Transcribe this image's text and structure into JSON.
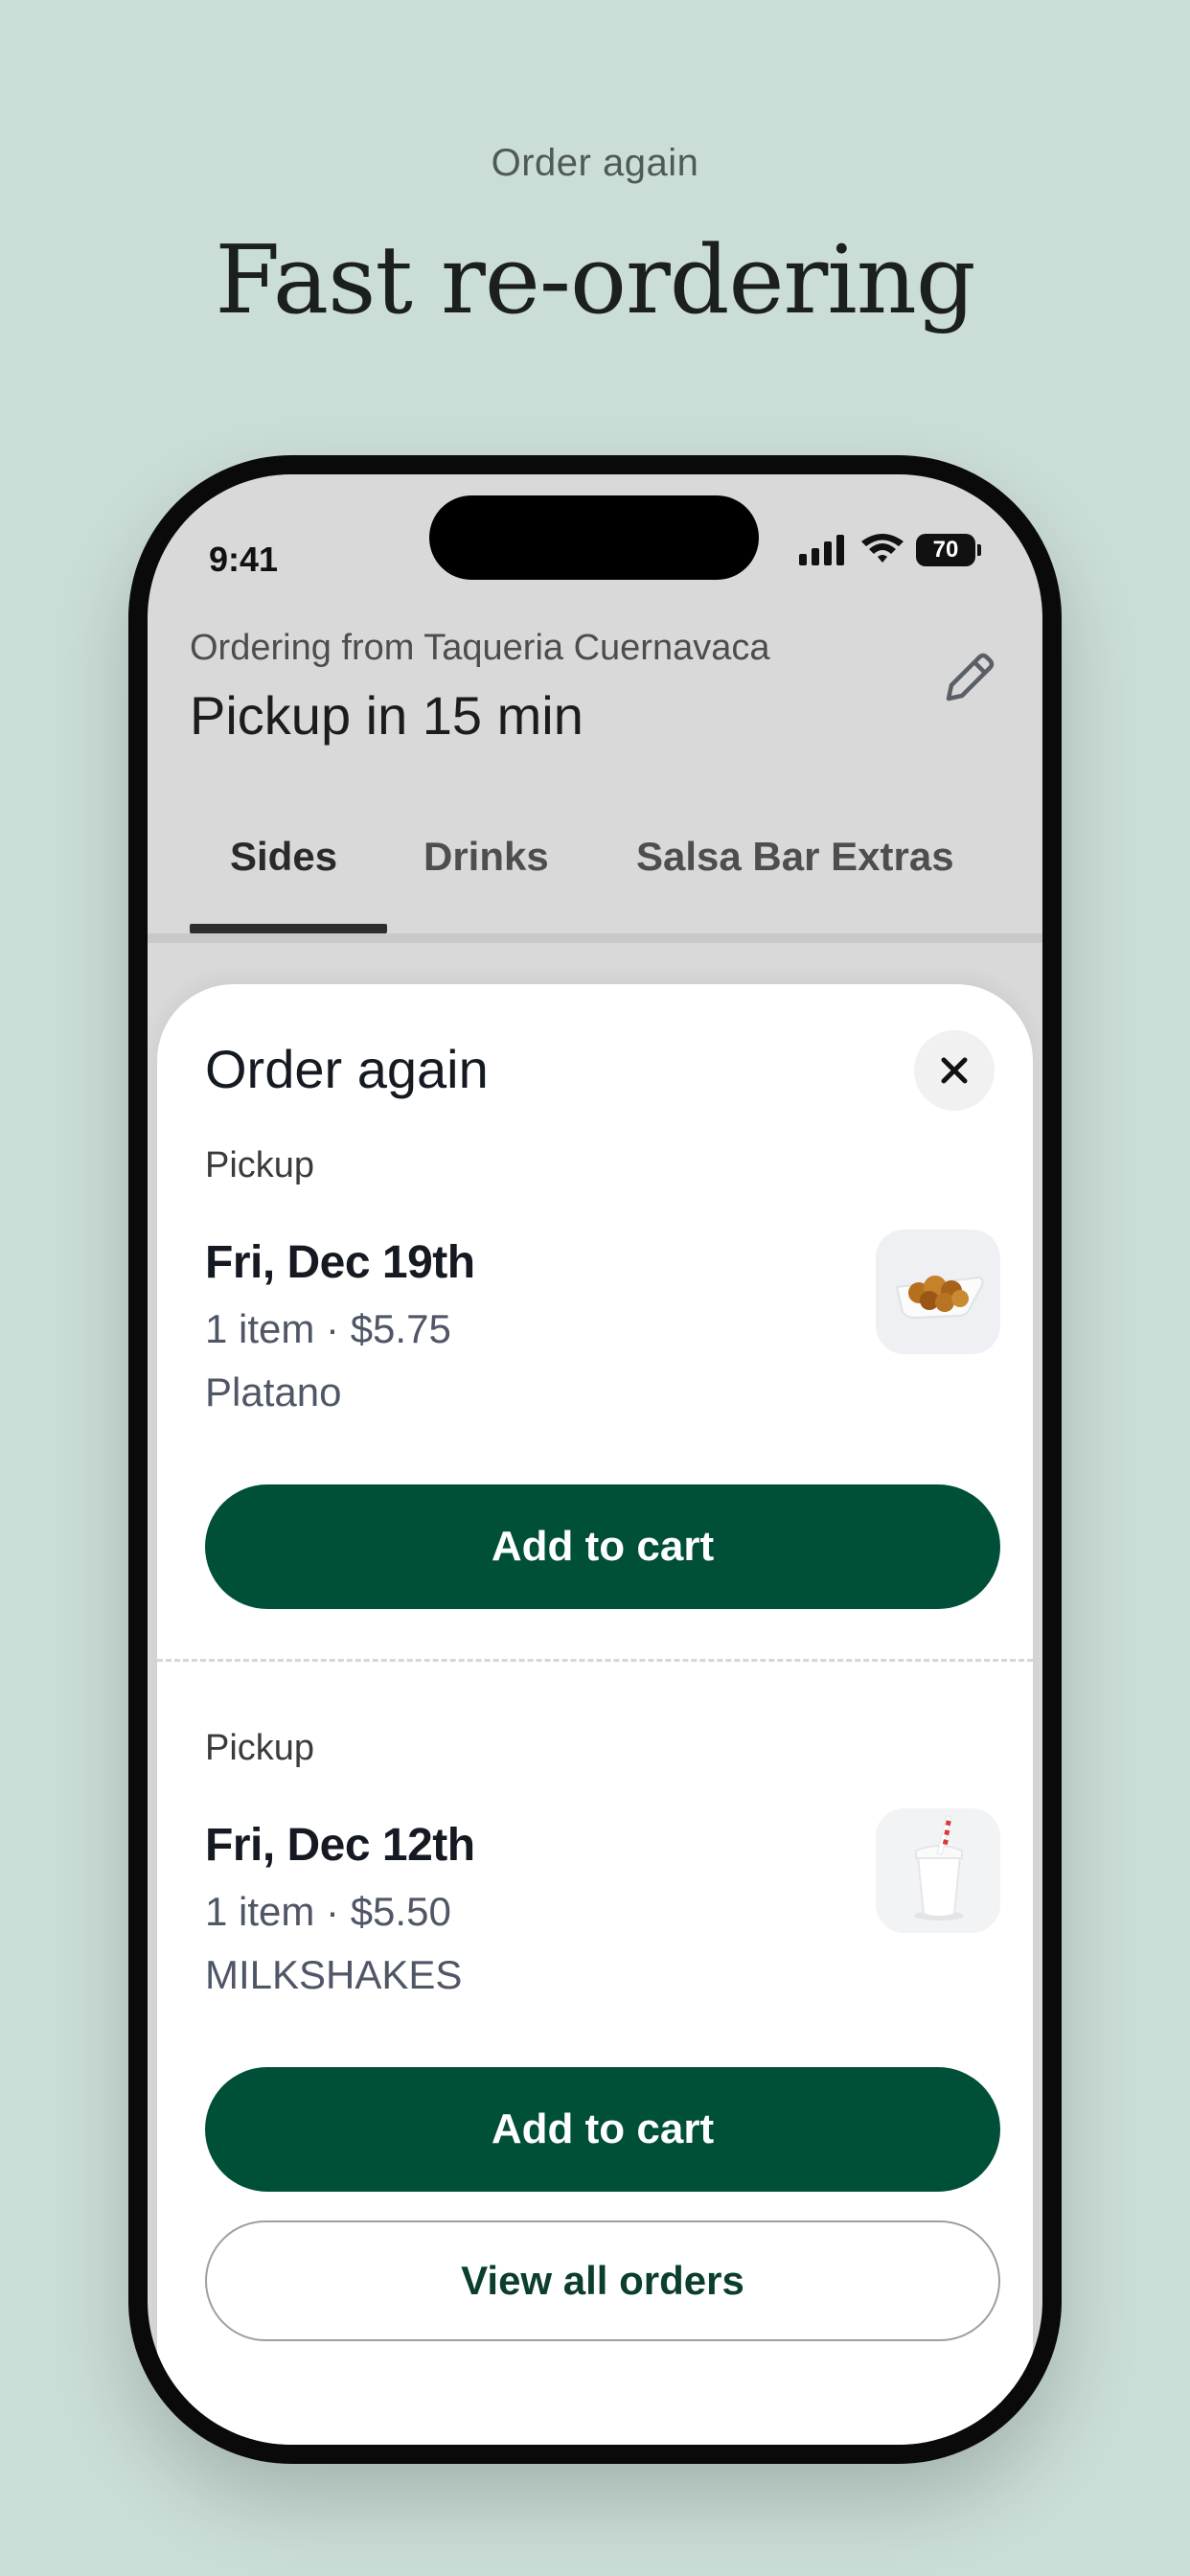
{
  "promo": {
    "eyebrow": "Order again",
    "title": "Fast re-ordering"
  },
  "status_bar": {
    "time": "9:41",
    "battery": "70"
  },
  "header": {
    "ordering_from": "Ordering from Taqueria Cuernavaca",
    "pickup_time": "Pickup in 15 min"
  },
  "tabs": [
    {
      "label": "Sides",
      "active": true
    },
    {
      "label": "Drinks",
      "active": false
    },
    {
      "label": "Salsa Bar Extras",
      "active": false
    }
  ],
  "sheet": {
    "title": "Order again",
    "orders": [
      {
        "type": "Pickup",
        "date": "Fri, Dec 19th",
        "summary": "1 item · $5.75",
        "items": "Platano",
        "button": "Add to cart",
        "thumb_icon": "fried-plantain-image"
      },
      {
        "type": "Pickup",
        "date": "Fri, Dec 12th",
        "summary": "1 item · $5.50",
        "items": "MILKSHAKES",
        "button": "Add to cart",
        "thumb_icon": "milkshake-image"
      }
    ],
    "view_all": "View all orders"
  },
  "colors": {
    "background": "#cbddd7",
    "brand_green": "#004f38"
  }
}
